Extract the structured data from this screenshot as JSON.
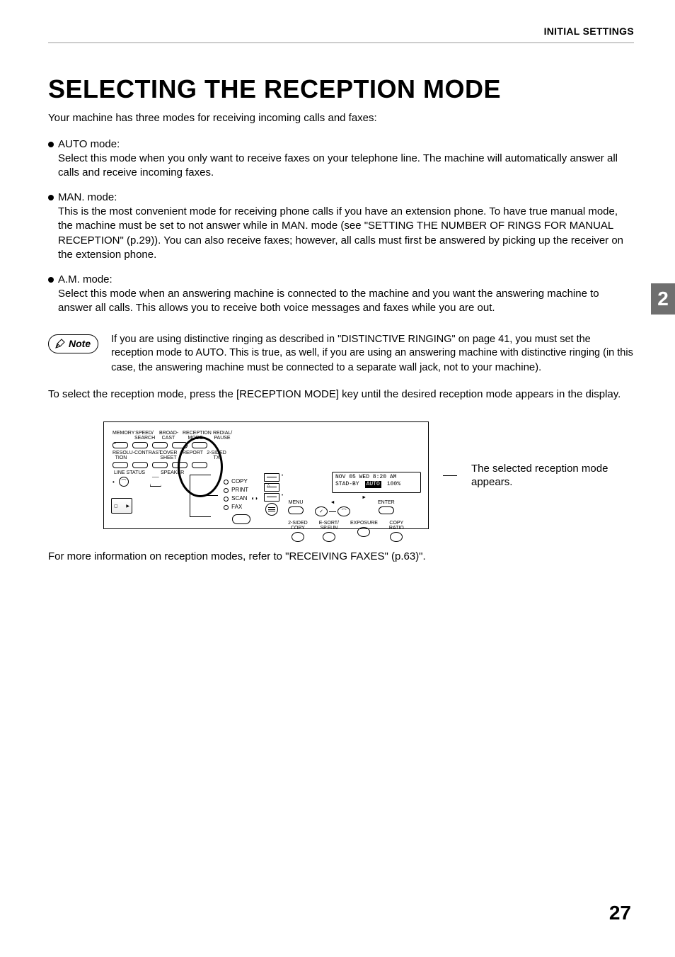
{
  "header": {
    "section_label": "INITIAL SETTINGS",
    "chapter_tab": "2"
  },
  "headline": "SELECTING THE RECEPTION MODE",
  "intro": "Your machine has three modes for receiving incoming calls and faxes:",
  "modes": [
    {
      "title": "AUTO mode:",
      "body": "Select this mode when you only want to receive faxes on your telephone line. The machine will automatically answer all calls and receive incoming faxes."
    },
    {
      "title": "MAN. mode:",
      "body": "This is the most convenient mode for receiving phone calls if you have an extension phone. To have true manual mode, the machine must be set to not answer while in MAN. mode (see \"SETTING THE NUMBER OF RINGS FOR MANUAL RECEPTION\" (p.29)). You can also receive faxes; however, all calls must first be answered by picking up the receiver on the extension phone."
    },
    {
      "title": "A.M. mode:",
      "body": "Select this mode when an answering machine is connected to the machine and you want the answering machine to answer all calls. This allows you to receive both voice messages and faxes while you are out."
    }
  ],
  "note": {
    "label": "Note",
    "text_part1": "If you are using distinctive ringing as described in \"DISTINCTIVE RINGING\" on page 41, you must set the reception mode to AUTO. This is true, as well, if you are using an answering machine with distinctive ringing (in this case, the answering machine must be connected to a separate wall jack, not to your ",
    "text_machine": "machine",
    "text_part2": ")."
  },
  "select_instruction": "To select the reception mode, press the [RECEPTION MODE] key until the desired reception mode appears in the display.",
  "panel": {
    "top_labels": [
      "MEMORY",
      "SPEED/\nSEARCH",
      "BROAD-\nCAST",
      "RECEPTION\nMODE",
      "REDIAL/\nPAUSE"
    ],
    "mid_labels": [
      "RESOLU-\nTION",
      "CONTRAST",
      "COVER\nSHEET",
      "REPORT",
      "2-SIDED TX"
    ],
    "line_status": "LINE STATUS",
    "speaker": "SPEAKER",
    "mode_list": [
      "COPY",
      "PRINT",
      "SCAN",
      "FAX"
    ],
    "lcd_line1": "NOV 05 WED  8:20 AM",
    "lcd_standby": "STAD-BY",
    "lcd_mode": "AUTO",
    "lcd_percent": "100%",
    "menu": "MENU",
    "enter": "ENTER",
    "bottom_labels": [
      "2-SIDED\nCOPY",
      "E-SORT/\nSP.FUN",
      "EXPOSURE",
      "COPY\nRATIO"
    ]
  },
  "callout": "The selected reception mode appears.",
  "more_info": "For more information on reception modes, refer to \"RECEIVING FAXES\" (p.63)\".",
  "page_number": "27"
}
